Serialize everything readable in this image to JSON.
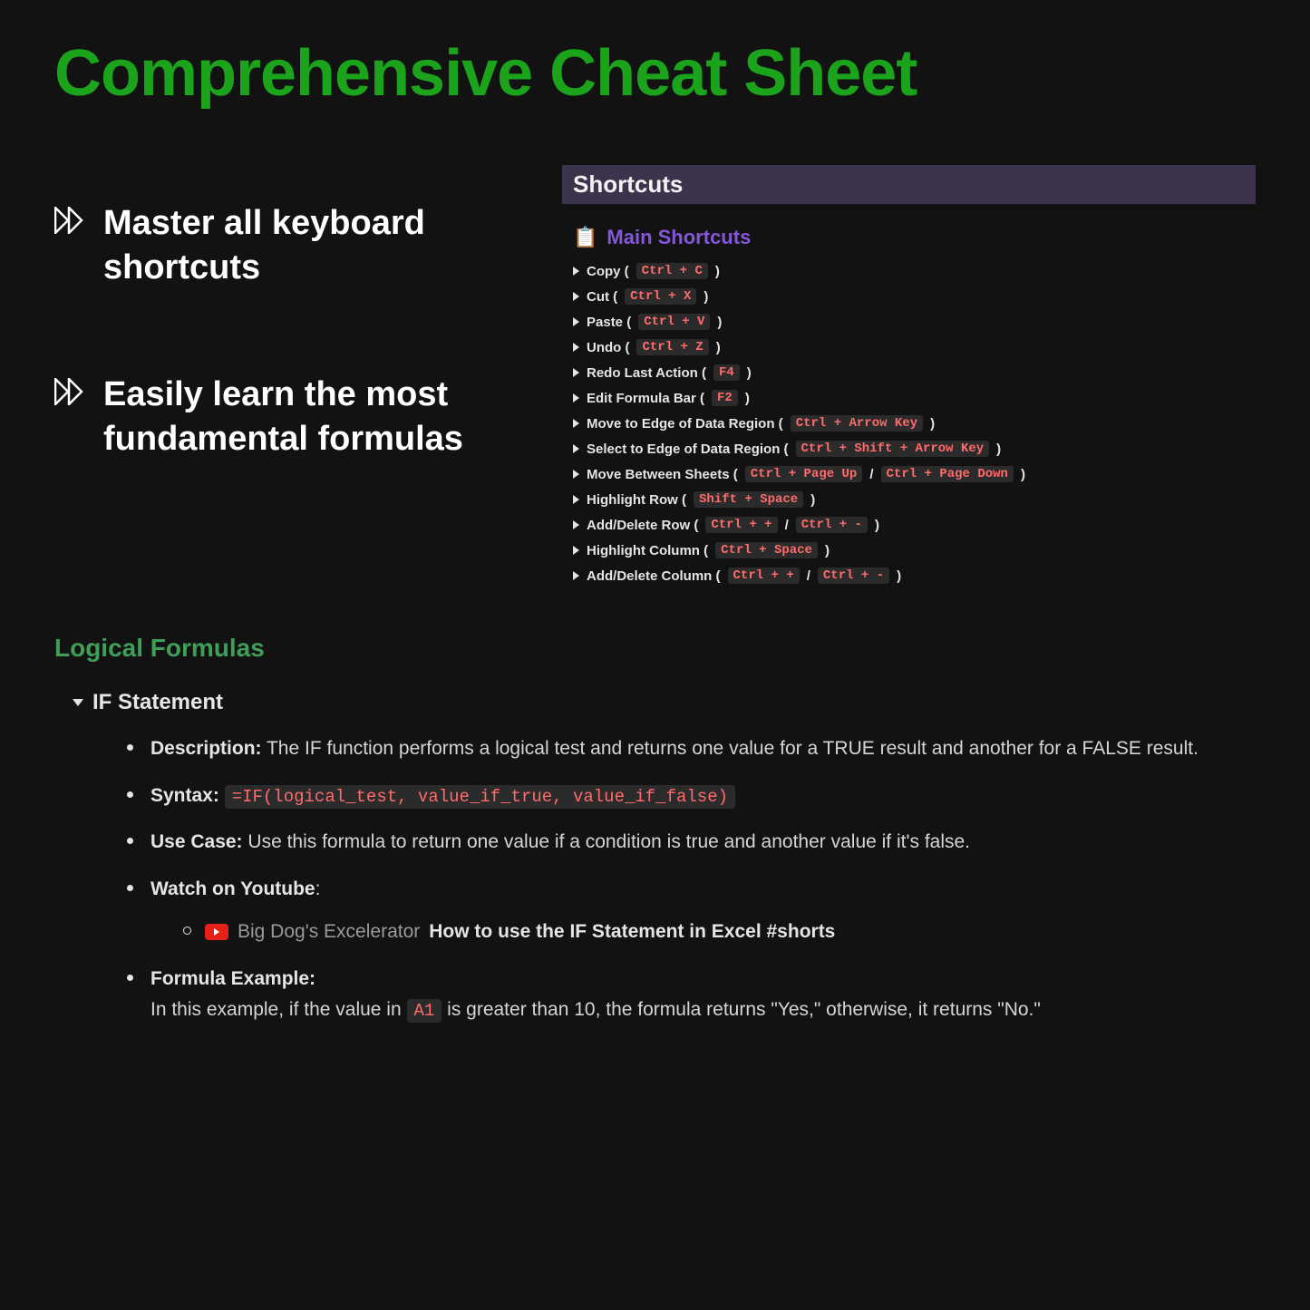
{
  "title": "Comprehensive Cheat Sheet",
  "bullets": [
    "Master all keyboard shortcuts",
    "Easily learn the most fundamental formulas"
  ],
  "shortcuts": {
    "header": "Shortcuts",
    "subheader": "Main Shortcuts",
    "items": [
      {
        "label": "Copy",
        "keys": [
          "Ctrl + C"
        ]
      },
      {
        "label": "Cut",
        "keys": [
          "Ctrl + X"
        ]
      },
      {
        "label": "Paste",
        "keys": [
          "Ctrl + V"
        ]
      },
      {
        "label": "Undo",
        "keys": [
          "Ctrl + Z"
        ]
      },
      {
        "label": "Redo Last Action",
        "keys": [
          "F4"
        ]
      },
      {
        "label": "Edit Formula Bar",
        "keys": [
          "F2"
        ]
      },
      {
        "label": "Move to Edge of Data Region",
        "keys": [
          "Ctrl + Arrow Key"
        ]
      },
      {
        "label": "Select to Edge of Data Region",
        "keys": [
          "Ctrl + Shift + Arrow Key"
        ]
      },
      {
        "label": "Move Between Sheets",
        "keys": [
          "Ctrl + Page Up",
          "Ctrl + Page Down"
        ]
      },
      {
        "label": "Highlight Row",
        "keys": [
          "Shift + Space"
        ]
      },
      {
        "label": "Add/Delete Row",
        "keys": [
          "Ctrl + +",
          "Ctrl + -"
        ]
      },
      {
        "label": "Highlight Column",
        "keys": [
          "Ctrl + Space"
        ]
      },
      {
        "label": "Add/Delete Column",
        "keys": [
          "Ctrl + +",
          "Ctrl + -"
        ]
      }
    ]
  },
  "logical": {
    "heading": "Logical Formulas",
    "item_title": "IF Statement",
    "desc_label": "Description:",
    "desc_text": "The IF function performs a logical test and returns one value for a TRUE result and another for a FALSE result.",
    "syntax_label": "Syntax:",
    "syntax_code": "=IF(logical_test, value_if_true, value_if_false)",
    "usecase_label": "Use Case:",
    "usecase_text": "Use this formula to return one value if a condition is true and another value if it's false.",
    "watch_label": "Watch on Youtube",
    "yt_channel": "Big Dog's Excelerator",
    "yt_title": "How to use the IF Statement in Excel #shorts",
    "example_label": "Formula Example:",
    "example_pre": "In this example, if the value in ",
    "example_cell": "A1",
    "example_post": " is greater than 10, the formula returns \"Yes,\" otherwise, it returns \"No.\""
  }
}
